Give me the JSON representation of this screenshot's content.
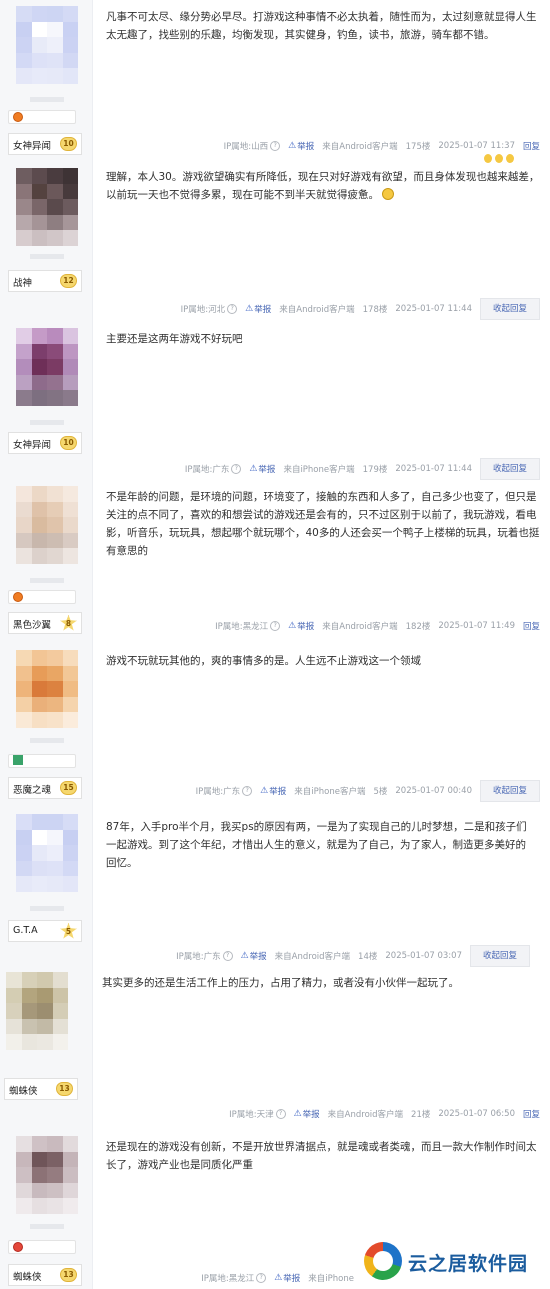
{
  "colors": {
    "accent": "#4867b4",
    "meta_text": "#9aa0a8",
    "badge_gold": "#f5d76e",
    "sidebar_bg": "#f6f7f9"
  },
  "icons": {
    "report": "warning-triangle-icon",
    "help": "question-circle-icon",
    "level": "level-badge-icon"
  },
  "posts": [
    {
      "user": {
        "name": "女神异闻",
        "level": "10"
      },
      "content": "凡事不可太尽、缘分势必早尽。打游戏这种事情不必太执着，随性而为，太过刻意就显得人生太无趣了，找些别的乐趣，均衡发现，其实健身，钓鱼，读书，旅游，骑车都不错。",
      "meta": {
        "ip": "IP属地:山西",
        "report": "举报",
        "client": "来自Android客户端",
        "floor": "175楼",
        "time": "2025-01-07 11:37",
        "reply": "回复"
      }
    },
    {
      "user": {
        "name": "战神",
        "level": "12"
      },
      "content": "理解，本人30。游戏欲望确实有所降低，现在只对好游戏有欲望，而且身体发现也越来越差，以前玩一天也不觉得多累，现在可能不到半天就觉得疲惫。",
      "meta": {
        "ip": "IP属地:河北",
        "report": "举报",
        "client": "来自Android客户端",
        "floor": "178楼",
        "time": "2025-01-07 11:44",
        "reply": "收起回复"
      }
    },
    {
      "user": {
        "name": "女神异闻",
        "level": "10"
      },
      "content": "主要还是这两年游戏不好玩吧",
      "meta": {
        "ip": "IP属地:广东",
        "report": "举报",
        "client": "来自iPhone客户端",
        "floor": "179楼",
        "time": "2025-01-07 11:44",
        "reply": "收起回复"
      }
    },
    {
      "user": {
        "name": "黑色沙翼",
        "level": "8"
      },
      "content": "不是年龄的问题，是环境的问题，环境变了，接触的东西和人多了，自己多少也变了，但只是关注的点不同了，喜欢的和想尝试的游戏还是会有的，只不过区别于以前了，我玩游戏，看电影，听音乐，玩玩具，想起哪个就玩哪个，40多的人还会买一个鸭子上楼梯的玩具，玩着也挺有意思的",
      "meta": {
        "ip": "IP属地:黑龙江",
        "report": "举报",
        "client": "来自Android客户端",
        "floor": "182楼",
        "time": "2025-01-07 11:49",
        "reply": "回复"
      }
    },
    {
      "user": {
        "name": "恶魔之魂",
        "level": "15"
      },
      "content": "游戏不玩就玩其他的，爽的事情多的是。人生远不止游戏这一个领域",
      "meta": {
        "ip": "IP属地:广东",
        "report": "举报",
        "client": "来自iPhone客户端",
        "floor": "5楼",
        "time": "2025-01-07 00:40",
        "reply": "收起回复"
      }
    },
    {
      "user": {
        "name": "G.T.A",
        "level": "5"
      },
      "content": "87年，入手pro半个月，我买ps的原因有两，一是为了实现自己的儿时梦想，二是和孩子们一起游戏。到了这个年纪，才惜出人生的意义，就是为了自己，为了家人，制造更多美好的回忆。",
      "meta": {
        "ip": "IP属地:广东",
        "report": "举报",
        "client": "来自Android客户端",
        "floor": "14楼",
        "time": "2025-01-07 03:07",
        "reply": "收起回复"
      }
    },
    {
      "user": {
        "name": "蜘蛛侠",
        "level": "13"
      },
      "content": "其实更多的还是生活工作上的压力，占用了精力，或者没有小伙伴一起玩了。",
      "meta": {
        "ip": "IP属地:天津",
        "report": "举报",
        "client": "来自Android客户端",
        "floor": "21楼",
        "time": "2025-01-07 06:50",
        "reply": "回复"
      }
    },
    {
      "user": {
        "name": "蜘蛛侠",
        "level": "13"
      },
      "content": "还是现在的游戏没有创新，不是开放世界清据点，就是魂或者类魂，而且一款大作制作时间太长了，游戏产业也是同质化严重",
      "meta": {
        "ip": "IP属地:黑龙江",
        "report": "举报",
        "client": "来自iPhone"
      }
    }
  ],
  "watermark": {
    "text": "云之居软件园"
  }
}
